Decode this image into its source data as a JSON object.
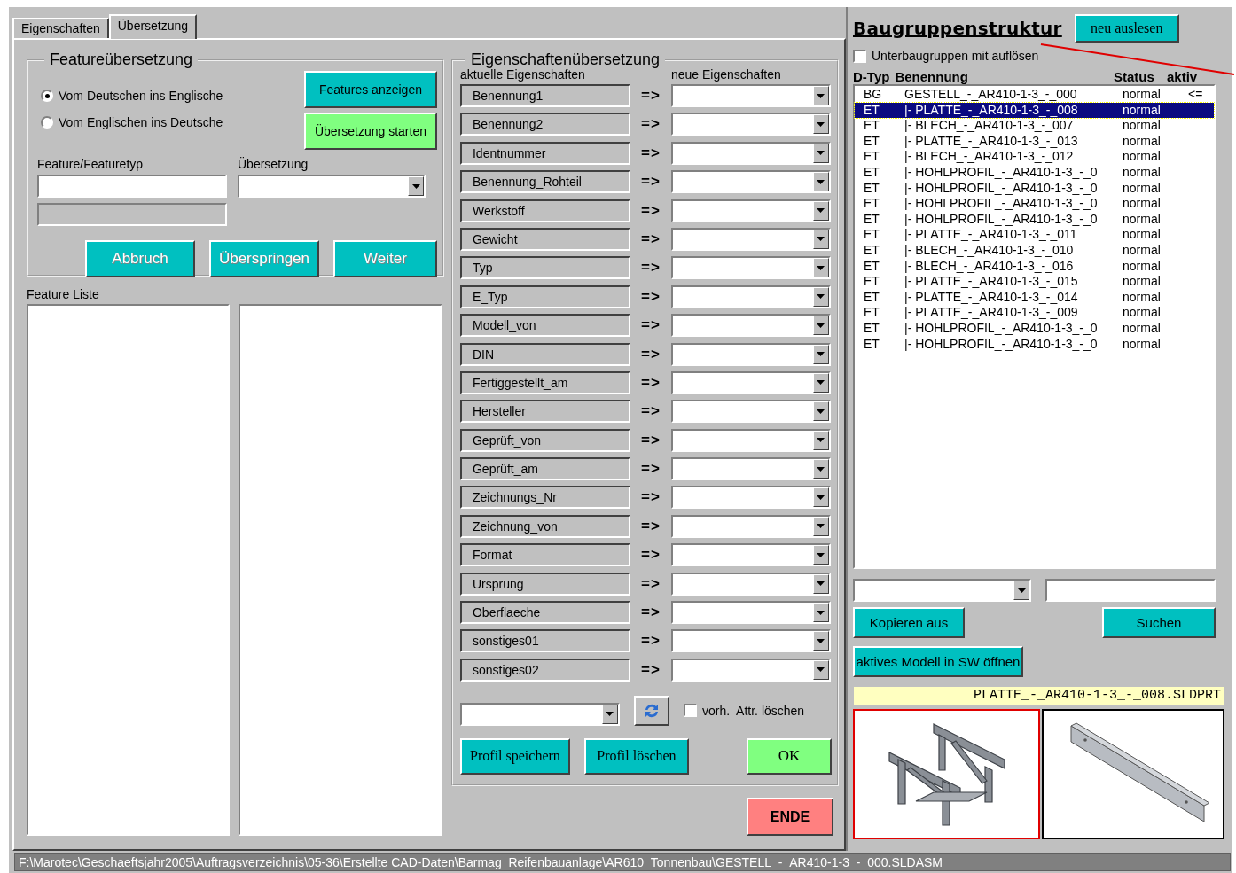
{
  "tabs": [
    {
      "label": "Eigenschaften",
      "selected": false
    },
    {
      "label": "Übersetzung",
      "selected": true
    }
  ],
  "feature_translation": {
    "title": "Featureübersetzung",
    "directions": [
      {
        "label": "Vom Deutschen ins Englische",
        "selected": true
      },
      {
        "label": "Vom Englischen ins Deutsche",
        "selected": false
      }
    ],
    "show_button": "Features anzeigen",
    "start_button": "Übersetzung starten",
    "feature_label": "Feature/Featuretyp",
    "translation_label": "Übersetzung",
    "buttons": [
      {
        "label": "Abbruch",
        "disabled": true
      },
      {
        "label": "Überspringen",
        "disabled": true
      },
      {
        "label": "Weiter",
        "disabled": true
      }
    ]
  },
  "feature_list": {
    "label": "Feature Liste"
  },
  "property_translation": {
    "title": "Eigenschaftenübersetzung",
    "current_header": "aktuelle Eigenschaften",
    "new_header": "neue Eigenschaften",
    "rows": [
      {
        "name": "Benennung1",
        "arrow": "=>"
      },
      {
        "name": "Benennung2",
        "arrow": "=>"
      },
      {
        "name": "Identnummer",
        "arrow": "=>"
      },
      {
        "name": "Benennung_Rohteil",
        "arrow": "=>"
      },
      {
        "name": "Werkstoff",
        "arrow": "=>"
      },
      {
        "name": "Gewicht",
        "arrow": "=>"
      },
      {
        "name": "Typ",
        "arrow": "=>"
      },
      {
        "name": "E_Typ",
        "arrow": "=>"
      },
      {
        "name": "Modell_von",
        "arrow": "=>"
      },
      {
        "name": "DIN",
        "arrow": "=>"
      },
      {
        "name": "Fertiggestellt_am",
        "arrow": "=>"
      },
      {
        "name": "Hersteller",
        "arrow": "=>"
      },
      {
        "name": "Geprüft_von",
        "arrow": "=>"
      },
      {
        "name": "Geprüft_am",
        "arrow": "=>"
      },
      {
        "name": "Zeichnungs_Nr",
        "arrow": "=>"
      },
      {
        "name": "Zeichnung_von",
        "arrow": "=>"
      },
      {
        "name": "Format",
        "arrow": "=>"
      },
      {
        "name": "Ursprung",
        "arrow": "=>"
      },
      {
        "name": "Oberflaeche",
        "arrow": "=>"
      },
      {
        "name": "sonstiges01",
        "arrow": "=>"
      },
      {
        "name": "sonstiges02",
        "arrow": "=>"
      }
    ],
    "delete_existing": {
      "label": "vorh.  Attr. löschen",
      "checked": false
    },
    "buttons": [
      "Profil speichern",
      "Profil löschen"
    ],
    "ok_button": "OK"
  },
  "end_button": "ENDE",
  "assembly": {
    "title": "Baugruppenstruktur",
    "reload_button": "neu auslesen",
    "resolve_subassemblies": {
      "label": "Unterbaugruppen mit auflösen",
      "checked": false
    },
    "columns": [
      "D-Typ",
      "Benennung",
      "Status",
      "aktiv"
    ],
    "rows": [
      {
        "type": "BG",
        "name": "GESTELL_-_AR410-1-3_-_000",
        "status": "normal",
        "active": "<=",
        "selected": false
      },
      {
        "type": "ET",
        "name": "|- PLATTE_-_AR410-1-3_-_008",
        "status": "normal",
        "selected": true
      },
      {
        "type": "ET",
        "name": "|- BLECH_-_AR410-1-3_-_007",
        "status": "normal",
        "selected": false
      },
      {
        "type": "ET",
        "name": "|- PLATTE_-_AR410-1-3_-_013",
        "status": "normal",
        "selected": false
      },
      {
        "type": "ET",
        "name": "|- BLECH_-_AR410-1-3_-_012",
        "status": "normal",
        "selected": false
      },
      {
        "type": "ET",
        "name": "|- HOHLPROFIL_-_AR410-1-3_-_0",
        "status": "normal",
        "selected": false
      },
      {
        "type": "ET",
        "name": "|- HOHLPROFIL_-_AR410-1-3_-_0",
        "status": "normal",
        "selected": false
      },
      {
        "type": "ET",
        "name": "|- HOHLPROFIL_-_AR410-1-3_-_0",
        "status": "normal",
        "selected": false
      },
      {
        "type": "ET",
        "name": "|- HOHLPROFIL_-_AR410-1-3_-_0",
        "status": "normal",
        "selected": false
      },
      {
        "type": "ET",
        "name": "|- PLATTE_-_AR410-1-3_-_011",
        "status": "normal",
        "selected": false
      },
      {
        "type": "ET",
        "name": "|- BLECH_-_AR410-1-3_-_010",
        "status": "normal",
        "selected": false
      },
      {
        "type": "ET",
        "name": "|- BLECH_-_AR410-1-3_-_016",
        "status": "normal",
        "selected": false
      },
      {
        "type": "ET",
        "name": "|- PLATTE_-_AR410-1-3_-_015",
        "status": "normal",
        "selected": false
      },
      {
        "type": "ET",
        "name": "|- PLATTE_-_AR410-1-3_-_014",
        "status": "normal",
        "selected": false
      },
      {
        "type": "ET",
        "name": "|- PLATTE_-_AR410-1-3_-_009",
        "status": "normal",
        "selected": false
      },
      {
        "type": "ET",
        "name": "|- HOHLPROFIL_-_AR410-1-3_-_0",
        "status": "normal",
        "selected": false
      },
      {
        "type": "ET",
        "name": "|- HOHLPROFIL_-_AR410-1-3_-_0",
        "status": "normal",
        "selected": false
      }
    ],
    "copy_button": "Kopieren aus",
    "search_button": "Suchen",
    "open_button": "aktives Modell in SW öffnen",
    "file_name": "PLATTE_-_AR410-1-3_-_008.SLDPRT",
    "previews": [
      {
        "kind": "assembly",
        "selected": true
      },
      {
        "kind": "part",
        "selected": false
      }
    ]
  },
  "status_bar": "F:\\Marotec\\Geschaeftsjahr2005\\Auftragsverzeichnis\\05-36\\Erstellte CAD-Daten\\Barmag_Reifenbauanlage\\AR610_Tonnenbau\\GESTELL_-_AR410-1-3_-_000.SLDASM"
}
